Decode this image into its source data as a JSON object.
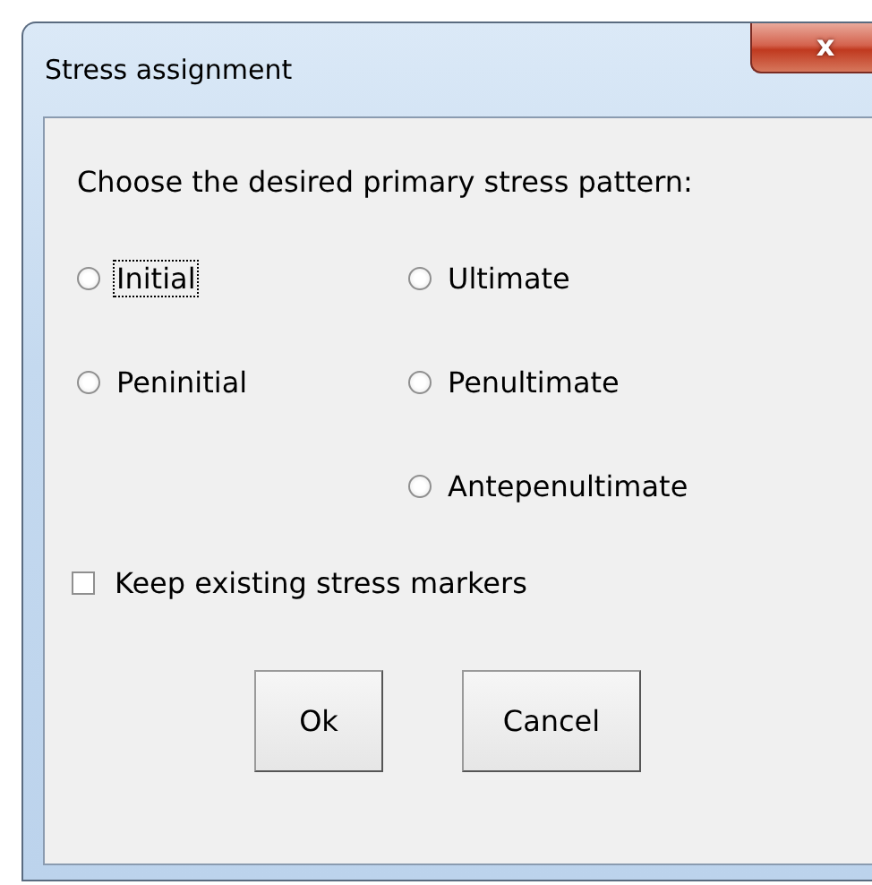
{
  "window": {
    "title": "Stress assignment",
    "close_label": "x"
  },
  "prompt": "Choose the desired primary stress pattern:",
  "radio_columns": [
    [
      {
        "label": "Initial",
        "selected": false,
        "focused": true
      },
      {
        "label": "Peninitial",
        "selected": false,
        "focused": false
      }
    ],
    [
      {
        "label": "Ultimate",
        "selected": false,
        "focused": false
      },
      {
        "label": "Penultimate",
        "selected": false,
        "focused": false
      },
      {
        "label": "Antepenultimate",
        "selected": false,
        "focused": false
      }
    ]
  ],
  "checkbox": {
    "label": "Keep existing stress markers",
    "checked": false
  },
  "buttons": [
    "Ok",
    "Cancel"
  ]
}
